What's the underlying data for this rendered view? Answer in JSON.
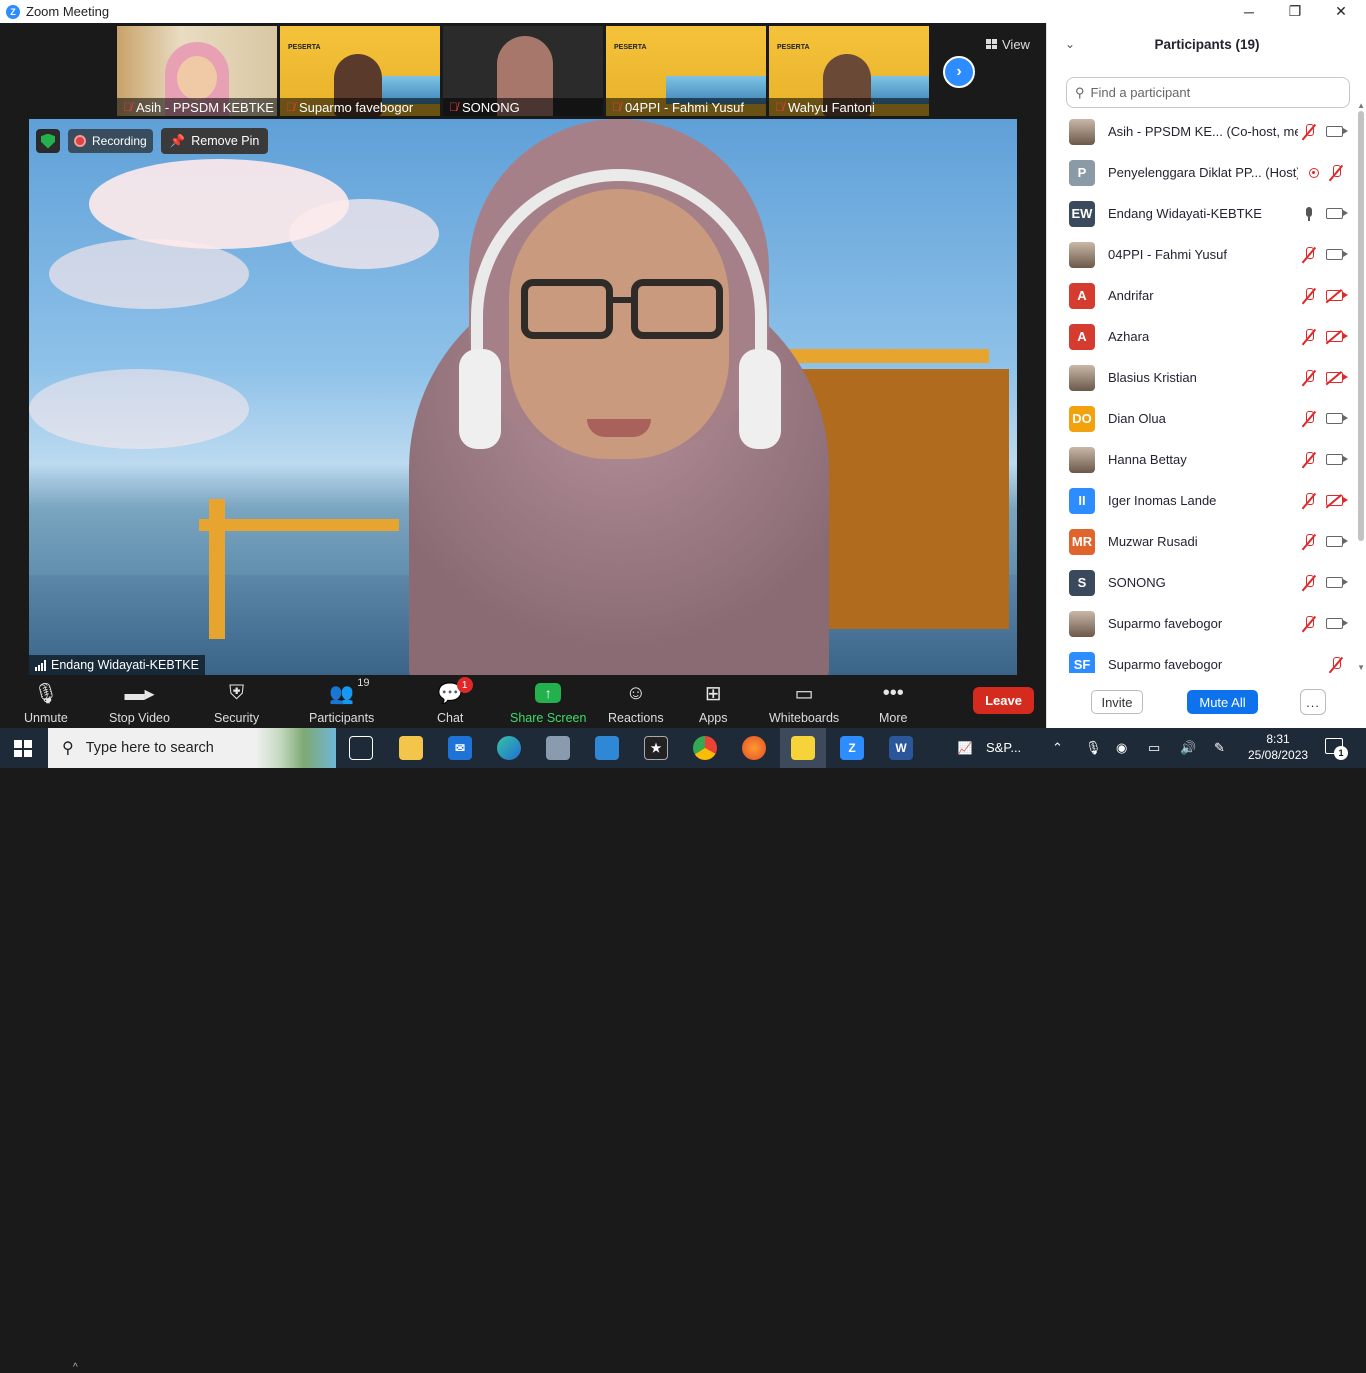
{
  "window": {
    "title": "Zoom Meeting",
    "min": "─",
    "max": "❐",
    "close": "✕"
  },
  "thumbnails": [
    {
      "name": "Asih - PPSDM KEBTKE",
      "style": "room"
    },
    {
      "name": "Suparmo favebogor",
      "style": "poster",
      "poster_text": "PESERTA"
    },
    {
      "name": "SONONG",
      "style": "grey"
    },
    {
      "name": "04PPI - Fahmi Yusuf",
      "style": "poster",
      "poster_text": "PESERTA"
    },
    {
      "name": "Wahyu Fantoni",
      "style": "poster",
      "poster_text": "PESERTA"
    }
  ],
  "view_button": "View",
  "main_video": {
    "recording_label": "Recording",
    "remove_pin_label": "Remove Pin",
    "speaker_name": "Endang Widayati-KEBTKE"
  },
  "toolbar": {
    "unmute": "Unmute",
    "stop_video": "Stop Video",
    "security": "Security",
    "participants": "Participants",
    "participants_count": "19",
    "chat": "Chat",
    "chat_badge": "1",
    "share_screen": "Share Screen",
    "reactions": "Reactions",
    "apps": "Apps",
    "whiteboards": "Whiteboards",
    "more": "More",
    "leave": "Leave",
    "share_color": "#22b14c",
    "leave_color": "#d52b1e"
  },
  "participants_panel": {
    "title": "Participants (19)",
    "search_placeholder": "Find a participant",
    "invite": "Invite",
    "mute_all": "Mute All",
    "more": "...",
    "list": [
      {
        "name": "Asih - PPSDM KE... (Co-host, me)",
        "avatar": "",
        "avatar_color": "photo",
        "mic": "off",
        "cam": "on"
      },
      {
        "name": "Penyelenggara Diklat PP... (Host)",
        "avatar": "P",
        "avatar_color": "#8a9aa6",
        "mic": "rec",
        "cam": "micoff"
      },
      {
        "name": "Endang Widayati-KEBTKE",
        "avatar": "EW",
        "avatar_color": "#3a4a5c",
        "mic": "on",
        "cam": "on"
      },
      {
        "name": "04PPI - Fahmi Yusuf",
        "avatar": "",
        "avatar_color": "photo",
        "mic": "off",
        "cam": "on"
      },
      {
        "name": "Andrifar",
        "avatar": "A",
        "avatar_color": "#d63b2f",
        "mic": "off",
        "cam": "off"
      },
      {
        "name": "Azhara",
        "avatar": "A",
        "avatar_color": "#d63b2f",
        "mic": "off",
        "cam": "off"
      },
      {
        "name": "Blasius Kristian",
        "avatar": "",
        "avatar_color": "photo",
        "mic": "off",
        "cam": "off"
      },
      {
        "name": "Dian Olua",
        "avatar": "DO",
        "avatar_color": "#f2a20c",
        "mic": "off",
        "cam": "on"
      },
      {
        "name": "Hanna Bettay",
        "avatar": "",
        "avatar_color": "photo",
        "mic": "off",
        "cam": "on"
      },
      {
        "name": "Iger Inomas Lande",
        "avatar": "II",
        "avatar_color": "#2d8cff",
        "mic": "off",
        "cam": "off"
      },
      {
        "name": "Muzwar Rusadi",
        "avatar": "MR",
        "avatar_color": "#e0642c",
        "mic": "off",
        "cam": "on"
      },
      {
        "name": "SONONG",
        "avatar": "S",
        "avatar_color": "#3a4a5c",
        "mic": "off",
        "cam": "on"
      },
      {
        "name": "Suparmo favebogor",
        "avatar": "",
        "avatar_color": "photo",
        "mic": "off",
        "cam": "on"
      },
      {
        "name": "Suparmo favebogor",
        "avatar": "SF",
        "avatar_color": "#2d8cff",
        "mic": "none",
        "cam": "micoff"
      }
    ]
  },
  "taskbar": {
    "search_placeholder": "Type here to search",
    "pinned_label": "S&P...",
    "time": "8:31",
    "date": "25/08/2023",
    "notification_count": "1"
  }
}
